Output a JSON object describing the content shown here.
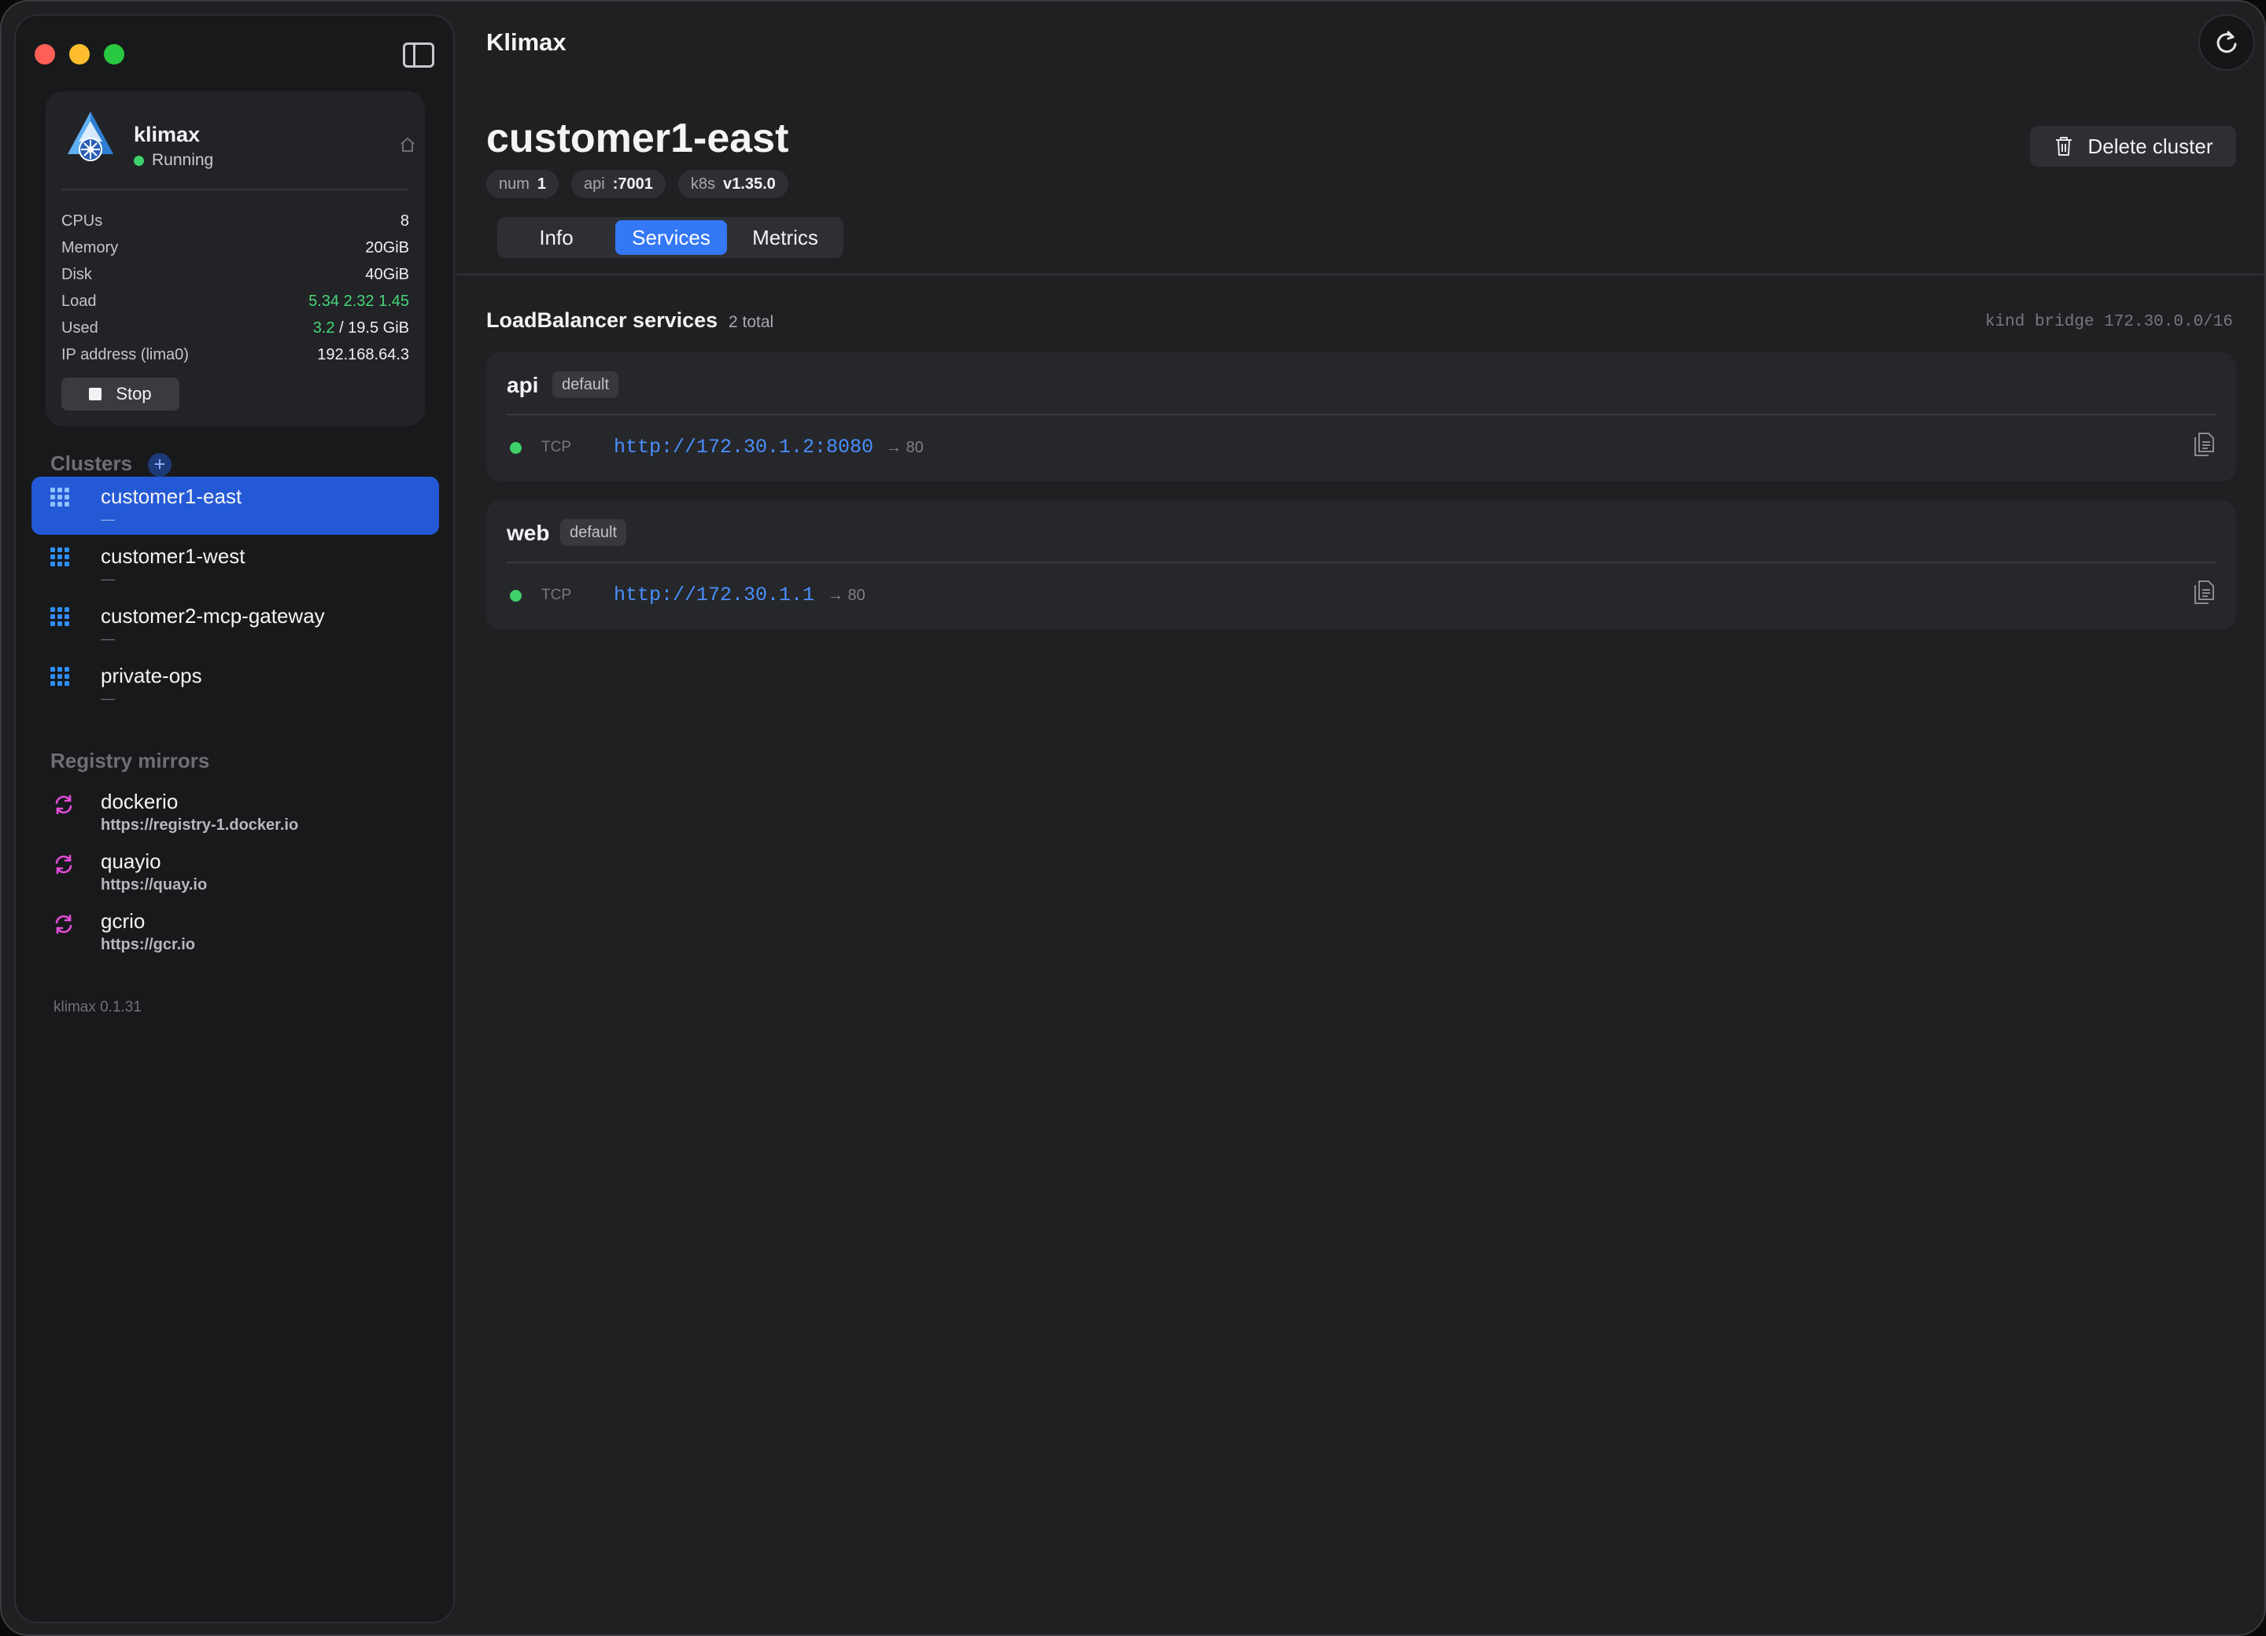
{
  "app": {
    "title": "Klimax"
  },
  "vm": {
    "name": "klimax",
    "status": "Running",
    "stats": [
      {
        "label": "CPUs",
        "value": "8"
      },
      {
        "label": "Memory",
        "value": "20GiB"
      },
      {
        "label": "Disk",
        "value": "40GiB"
      },
      {
        "label": "Load",
        "value": "5.34 2.32 1.45"
      },
      {
        "label": "Used",
        "value_used": "3.2",
        "value_total": "/ 19.5 GiB"
      },
      {
        "label": "IP address (lima0)",
        "value": "192.168.64.3"
      }
    ],
    "stop_label": "Stop"
  },
  "sidebar": {
    "clusters_title": "Clusters",
    "add_label": "+",
    "clusters": [
      {
        "name": "customer1-east",
        "sub": "—"
      },
      {
        "name": "customer1-west",
        "sub": "—"
      },
      {
        "name": "customer2-mcp-gateway",
        "sub": "—"
      },
      {
        "name": "private-ops",
        "sub": "—"
      }
    ],
    "mirrors_title": "Registry mirrors",
    "mirrors": [
      {
        "name": "dockerio",
        "url": "https://registry-1.docker.io"
      },
      {
        "name": "quayio",
        "url": "https://quay.io"
      },
      {
        "name": "gcrio",
        "url": "https://gcr.io"
      }
    ],
    "version": "klimax 0.1.31"
  },
  "cluster": {
    "title": "customer1-east",
    "chips": [
      {
        "key": "num",
        "value": "1"
      },
      {
        "key": "api",
        "value": ":7001"
      },
      {
        "key": "k8s",
        "value": "v1.35.0"
      }
    ],
    "delete_label": "Delete cluster",
    "tabs": [
      {
        "label": "Info"
      },
      {
        "label": "Services"
      },
      {
        "label": "Metrics"
      }
    ]
  },
  "services": {
    "title": "LoadBalancer services",
    "count": "2 total",
    "bridge": "kind bridge 172.30.0.0/16",
    "items": [
      {
        "name": "api",
        "namespace": "default",
        "protocol": "TCP",
        "url": "http://172.30.1.2:8080",
        "port": "→ 80"
      },
      {
        "name": "web",
        "namespace": "default",
        "protocol": "TCP",
        "url": "http://172.30.1.1",
        "port": "→ 80"
      }
    ]
  },
  "colors": {
    "accent": "#3478f6",
    "selection": "#2459d6",
    "running": "#3ed16a",
    "link": "#4a8fff",
    "mirror_icon": "#e24bd8"
  },
  "icons": [
    "sidebar-toggle-icon",
    "kubernetes-logo-icon",
    "home-icon",
    "stop-icon",
    "plus-icon",
    "grid-icon",
    "sync-icon",
    "refresh-icon",
    "trash-icon",
    "copy-icon"
  ]
}
